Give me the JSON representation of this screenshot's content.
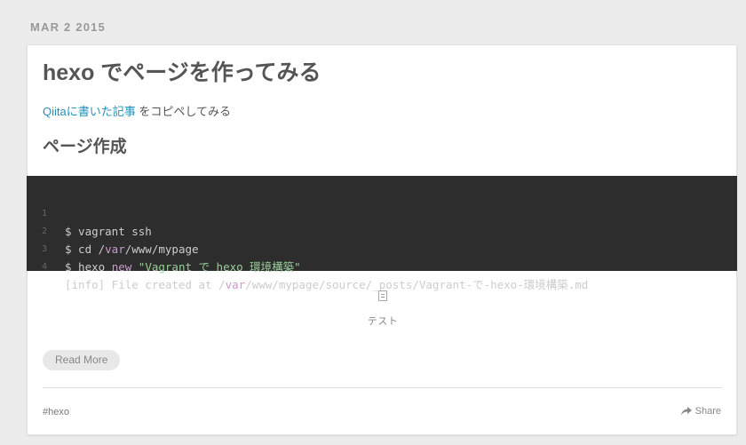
{
  "post": {
    "date": "MAR 2 2015",
    "title": "hexo でページを作ってみる",
    "intro_link": "Qiitaに書いた記事",
    "intro_text": " をコピペしてみる",
    "section_heading": "ページ作成",
    "image_caption": "テスト",
    "image_icon": "broken-image-icon",
    "read_more": "Read More",
    "tag": "#hexo",
    "share": "Share",
    "share_icon": "share-arrow-icon"
  },
  "code": {
    "line_numbers": [
      "1",
      "2",
      "3",
      "4"
    ],
    "line1": "$ vagrant ssh",
    "line2_a": "$ cd /",
    "line2_kw": "var",
    "line2_b": "/www/mypage",
    "line3_a": "$ hexo ",
    "line3_kw": "new",
    "line3_b": " ",
    "line3_str": "\"Vagrant で hexo 環境構築\"",
    "line4_a": "[info] File created at /",
    "line4_kw": "var",
    "line4_b": "/www/mypage/source/_posts/Vagrant-で-hexo-環境構築.md"
  },
  "colors": {
    "link": "#258fb8",
    "code_bg": "#2d2d2d",
    "keyword": "#cc99cc",
    "string": "#99cc99"
  }
}
